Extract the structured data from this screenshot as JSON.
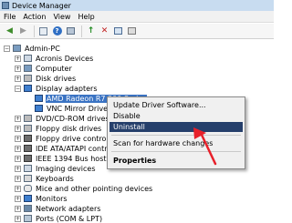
{
  "window": {
    "title": "Device Manager",
    "icon": "device-manager-icon"
  },
  "menu": [
    "File",
    "Action",
    "View",
    "Help"
  ],
  "toolbar": {
    "buttons": [
      "back-arrow-icon",
      "forward-arrow-icon",
      "properties-icon",
      "help-icon",
      "action-icon",
      "update-driver-icon",
      "uninstall-icon",
      "scan-hardware-icon",
      "disable-icon"
    ]
  },
  "tree": {
    "root": "Admin-PC",
    "items": [
      {
        "label": "Acronis Devices",
        "icon": "device-icon"
      },
      {
        "label": "Computer",
        "icon": "computer-icon"
      },
      {
        "label": "Disk drives",
        "icon": "disk-icon"
      },
      {
        "label": "Display adapters",
        "icon": "monitor-icon"
      },
      {
        "label": "AMD Radeon R7 200 Series",
        "icon": "display-adapter-icon",
        "selected": true
      },
      {
        "label": "VNC Mirror Driver",
        "icon": "display-adapter-icon"
      },
      {
        "label": "DVD/CD-ROM drives",
        "icon": "disk-icon"
      },
      {
        "label": "Floppy disk drives",
        "icon": "disk-icon"
      },
      {
        "label": "Floppy drive controllers",
        "icon": "chip-icon"
      },
      {
        "label": "IDE ATA/ATAPI controllers",
        "icon": "chip-icon"
      },
      {
        "label": "IEEE 1394 Bus host controllers",
        "icon": "chip-icon"
      },
      {
        "label": "Imaging devices",
        "icon": "camera-icon"
      },
      {
        "label": "Keyboards",
        "icon": "keyboard-icon"
      },
      {
        "label": "Mice and other pointing devices",
        "icon": "mouse-icon"
      },
      {
        "label": "Monitors",
        "icon": "monitor-icon"
      },
      {
        "label": "Network adapters",
        "icon": "network-icon"
      },
      {
        "label": "Ports (COM & LPT)",
        "icon": "port-icon"
      }
    ]
  },
  "context_menu": {
    "items": [
      {
        "label": "Update Driver Software..."
      },
      {
        "label": "Disable"
      },
      {
        "label": "Uninstall",
        "highlighted": true
      },
      {
        "label": "Scan for hardware changes"
      },
      {
        "label": "Properties",
        "bold": true
      }
    ]
  },
  "colors": {
    "selection": "#3a73c3",
    "menu_highlight": "#253f6b",
    "annotation_arrow": "#e8202a"
  }
}
